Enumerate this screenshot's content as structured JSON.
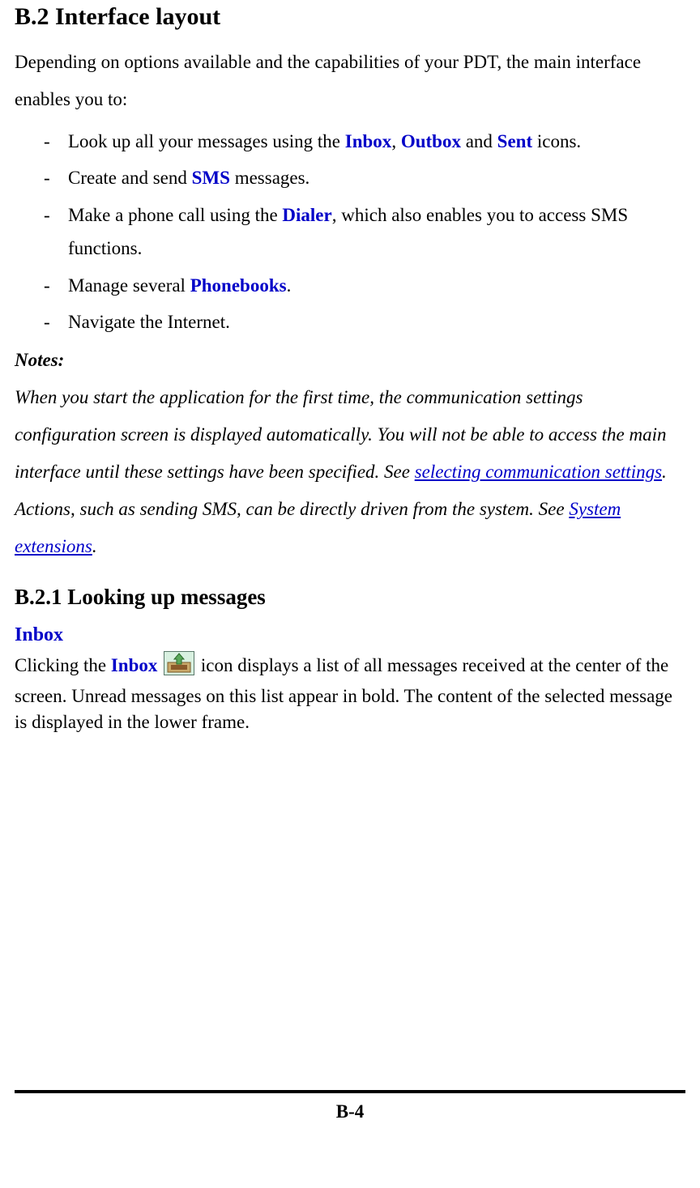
{
  "h1": "B.2 Interface layout",
  "intro": "Depending on options available and the capabilities of your PDT, the main interface enables you to:",
  "list": {
    "i1": {
      "a": "Look up all your messages using the ",
      "inbox": "Inbox",
      "c1": ", ",
      "outbox": "Outbox",
      "c2": " and ",
      "sent": "Sent",
      "c3": " icons."
    },
    "i2": {
      "a": "Create and send ",
      "sms": "SMS",
      "b": " messages."
    },
    "i3": {
      "a": "Make a phone call using the ",
      "dialer": "Dialer",
      "b": ", which also enables you to access SMS functions."
    },
    "i4": {
      "a": "Manage several ",
      "pb": "Phonebooks",
      "b": "."
    },
    "i5": "Navigate the Internet."
  },
  "notes": {
    "head": "Notes:",
    "p1a": "When you start the application for the first time, the communication settings configuration screen is displayed automatically. You will not be able to access the main interface until these settings have been specified. See ",
    "link1": "selecting communication settings",
    "p1b": ".",
    "p2a": "Actions, such as sending SMS, can be directly driven from the system. See ",
    "link2": "System extensions",
    "p2b": "."
  },
  "h2": "B.2.1 Looking up messages",
  "inbox": {
    "head": "Inbox",
    "a": "Clicking the ",
    "label": "Inbox",
    "b": " icon displays a list of all messages received at the center of the screen. Unread messages on this list appear in bold. The content of the selected message is displayed in the lower frame."
  },
  "page_number": "B-4"
}
